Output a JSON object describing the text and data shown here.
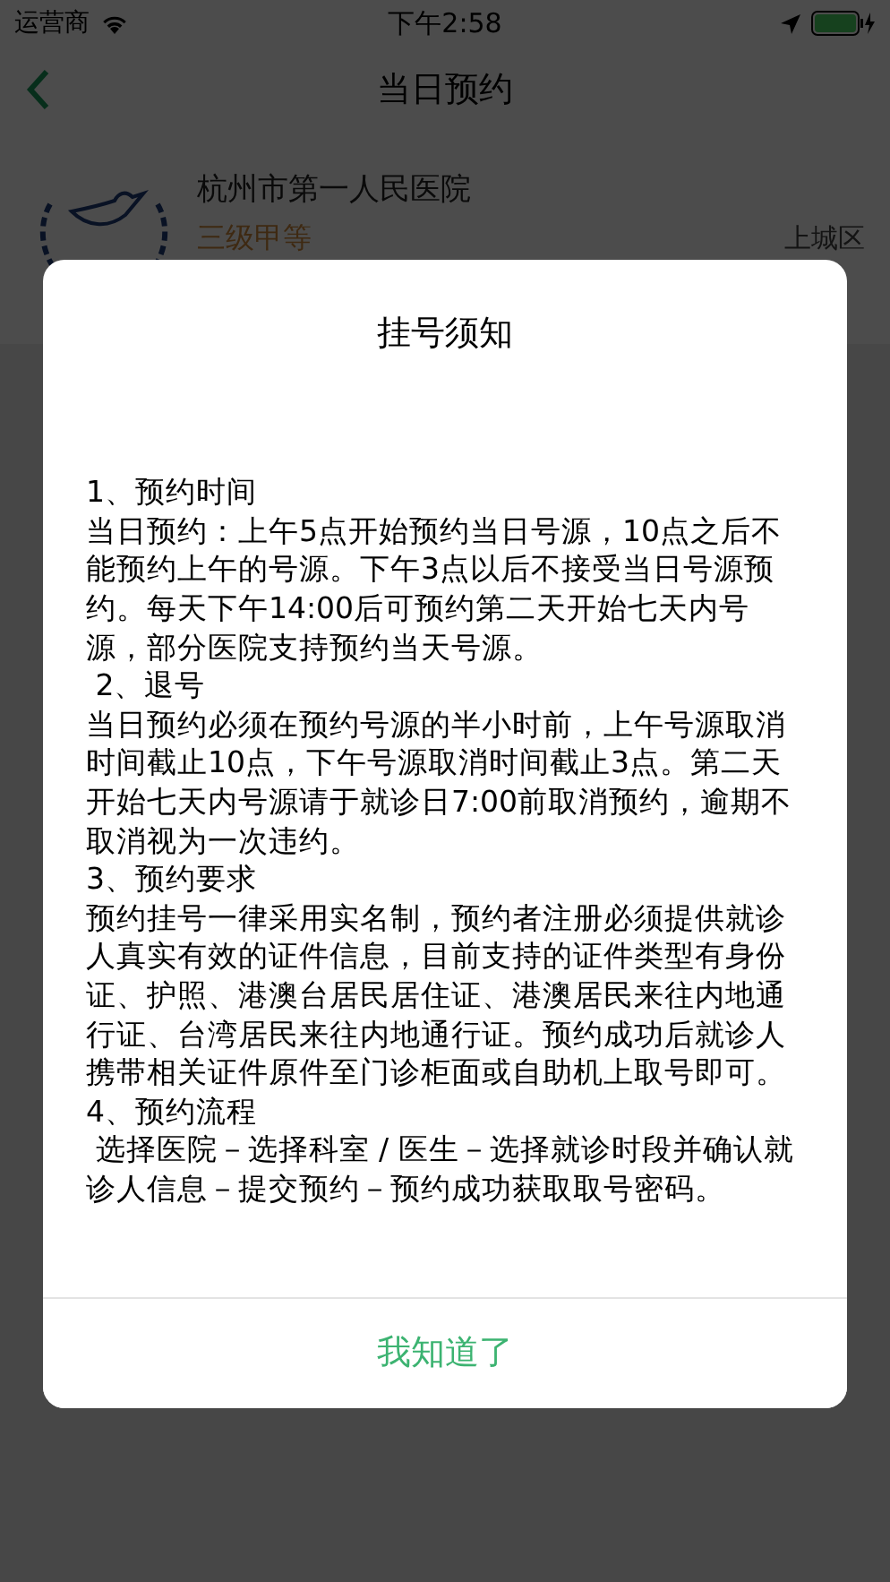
{
  "status_bar": {
    "carrier": "运营商",
    "time": "下午2:58"
  },
  "nav_bar": {
    "title": "当日预约"
  },
  "hospital": {
    "name": "杭州市第一人民医院",
    "level": "三级甲等",
    "district": "上城区"
  },
  "dialog": {
    "title": "挂号须知",
    "sections": [
      {
        "heading": "1、预约时间",
        "body": "当日预约：上午5点开始预约当日号源，10点之后不能预约上午的号源。下午3点以后不接受当日号源预约。每天下午14:00后可预约第二天开始七天内号源，部分医院支持预约当天号源。"
      },
      {
        "heading": " 2、退号",
        "body": "当日预约必须在预约号源的半小时前，上午号源取消时间截止10点，下午号源取消时间截止3点。第二天开始七天内号源请于就诊日7:00前取消预约，逾期不取消视为一次违约。"
      },
      {
        "heading": "3、预约要求",
        "body": "预约挂号一律采用实名制，预约者注册必须提供就诊人真实有效的证件信息，目前支持的证件类型有身份证、护照、港澳台居民居住证、港澳居民来往内地通行证、台湾居民来往内地通行证。预约成功后就诊人携带相关证件原件至门诊柜面或自助机上取号即可。"
      },
      {
        "heading": "4、预约流程",
        "body": " 选择医院－选择科室 / 医生－选择就诊时段并确认就诊人信息－提交预约－预约成功获取取号密码。"
      }
    ],
    "button": "我知道了"
  }
}
